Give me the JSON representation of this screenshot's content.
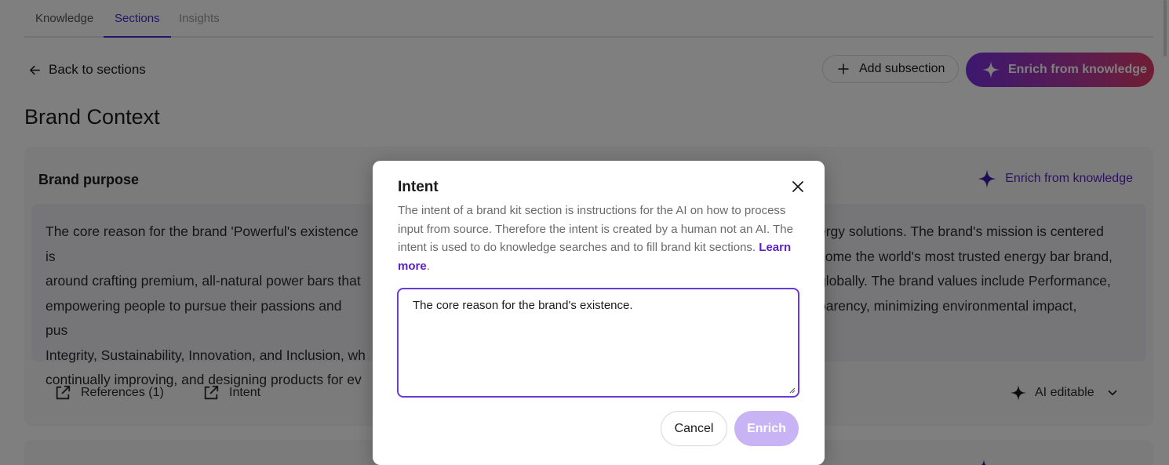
{
  "tabs": [
    {
      "label": "Knowledge",
      "state": "default"
    },
    {
      "label": "Sections",
      "state": "active"
    },
    {
      "label": "Insights",
      "state": "disabled"
    }
  ],
  "header": {
    "back_label": "Back to sections",
    "add_subsection_label": "Add subsection",
    "enrich_label": "Enrich from knowledge"
  },
  "section": {
    "title": "Brand Context"
  },
  "card": {
    "title": "Brand purpose",
    "enrich_label": "Enrich from knowledge",
    "body": "The core reason for the brand 'Powerful's existence is … ergy solutions. The brand's mission is centered around crafting premium, all-natural power bars that … come the world's most trusted energy bar brand, empowering people to pursue their passions and pus… globally. The brand values include Performance, Integrity, Sustainability, Innovation, and Inclusion, wh… parency, minimizing environmental impact, continually improving, and designing products for ev…",
    "body_lines": [
      {
        "left": "The core reason for the brand 'Powerful's existence is",
        "right": "ergy solutions. The brand's mission is centered"
      },
      {
        "left": "around crafting premium, all-natural power bars that",
        "right": "come the world's most trusted energy bar brand,"
      },
      {
        "left": "empowering people to pursue their passions and pus",
        "right": "globally. The brand values include Performance,"
      },
      {
        "left": "Integrity, Sustainability, Innovation, and Inclusion, wh",
        "right": "parency, minimizing environmental impact,"
      },
      {
        "left": "continually improving, and designing products for ev",
        "right": ""
      }
    ],
    "references_label": "References (1)",
    "intent_label": "Intent",
    "ai_editable_label": "AI editable"
  },
  "modal": {
    "title": "Intent",
    "description": "The intent of a brand kit section is instructions for the AI on how to process input from source. Therefore the intent is created by a human not an AI. The intent is used to do knowledge searches and to fill brand kit sections.",
    "learn_more": "Learn more",
    "textarea_value": "The core reason for the brand's existence.",
    "cancel_label": "Cancel",
    "enrich_label": "Enrich"
  },
  "colors": {
    "accent": "#5a22c7",
    "accent_border": "#6b3ad9",
    "enrich_disabled": "#c8b3f5",
    "gradient_start": "#7a2fe0",
    "gradient_end": "#e23a6a"
  },
  "icons": {
    "back": "arrow-left-icon",
    "add": "plus-icon",
    "enrich": "sparkle-icon",
    "close": "close-icon",
    "external": "external-link-icon",
    "chevron": "chevron-down-icon"
  }
}
